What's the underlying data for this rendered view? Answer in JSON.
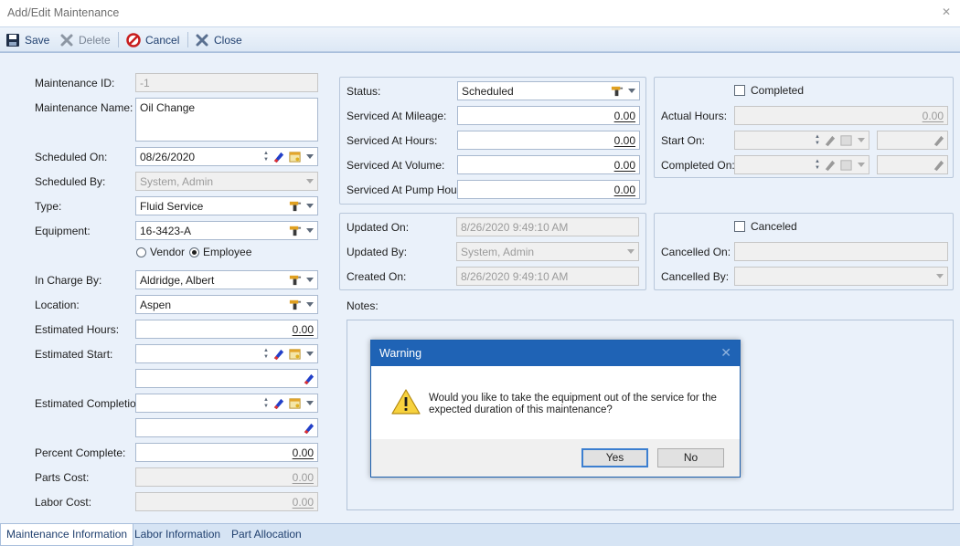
{
  "window": {
    "title": "Add/Edit Maintenance"
  },
  "toolbar": {
    "save": "Save",
    "delete": "Delete",
    "cancel": "Cancel",
    "close": "Close"
  },
  "form": {
    "maintenance_id_label": "Maintenance ID:",
    "maintenance_id": "-1",
    "maintenance_name_label": "Maintenance Name:",
    "maintenance_name": "Oil Change",
    "scheduled_on_label": "Scheduled On:",
    "scheduled_on": "08/26/2020",
    "scheduled_by_label": "Scheduled By:",
    "scheduled_by": "System, Admin",
    "type_label": "Type:",
    "type": "Fluid Service",
    "equipment_label": "Equipment:",
    "equipment": "16-3423-A",
    "vendor_label": "Vendor",
    "employee_label": "Employee",
    "in_charge_label": "In Charge By:",
    "in_charge": "Aldridge, Albert",
    "location_label": "Location:",
    "location": "Aspen",
    "est_hours_label": "Estimated Hours:",
    "est_hours": "0.00",
    "est_start_label": "Estimated Start:",
    "est_completion_label": "Estimated Completion:",
    "percent_label": "Percent Complete:",
    "percent": "0.00",
    "parts_cost_label": "Parts Cost:",
    "parts_cost": "0.00",
    "labor_cost_label": "Labor Cost:",
    "labor_cost": "0.00"
  },
  "status_group": {
    "status_label": "Status:",
    "status": "Scheduled",
    "mileage_label": "Serviced At Mileage:",
    "mileage": "0.00",
    "hours_label": "Serviced At Hours:",
    "hours": "0.00",
    "volume_label": "Serviced At Volume:",
    "volume": "0.00",
    "pump_label": "Serviced At Pump Hours:",
    "pump": "0.00"
  },
  "completed_group": {
    "completed_label": "Completed",
    "actual_hours_label": "Actual Hours:",
    "actual_hours": "0.00",
    "start_on_label": "Start On:",
    "completed_on_label": "Completed On:"
  },
  "updated_group": {
    "updated_on_label": "Updated On:",
    "updated_on": "8/26/2020 9:49:10 AM",
    "updated_by_label": "Updated By:",
    "updated_by": "System, Admin",
    "created_on_label": "Created On:",
    "created_on": "8/26/2020 9:49:10 AM"
  },
  "canceled_group": {
    "canceled_label": "Canceled",
    "cancelled_on_label": "Cancelled On:",
    "cancelled_by_label": "Cancelled By:"
  },
  "notes": {
    "label": "Notes:"
  },
  "tabs": [
    "Maintenance Information",
    "Labor Information",
    "Part Allocation"
  ],
  "dialog": {
    "title": "Warning",
    "message": "Would you like to take the equipment out of the service for the expected duration of this maintenance?",
    "yes": "Yes",
    "no": "No"
  },
  "colors": {
    "accent": "#1f63b5",
    "panel": "#eaf1fa",
    "toolbar": "#dde8f5"
  }
}
